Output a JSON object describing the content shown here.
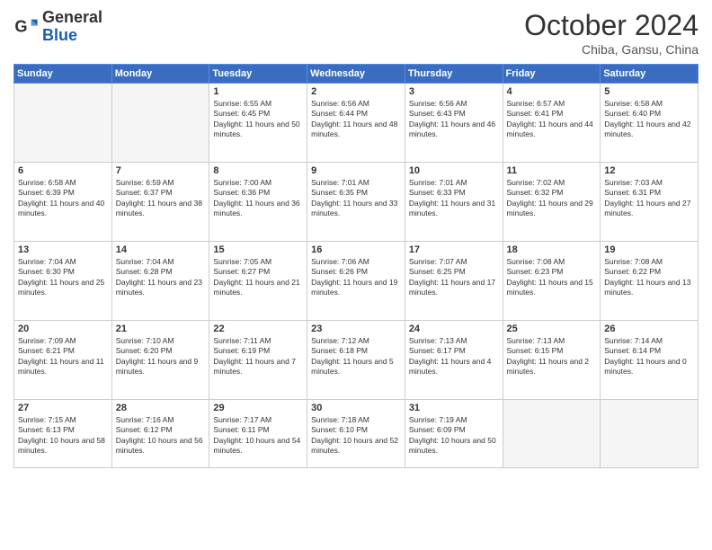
{
  "header": {
    "logo_general": "General",
    "logo_blue": "Blue",
    "month_title": "October 2024",
    "subtitle": "Chiba, Gansu, China"
  },
  "days_of_week": [
    "Sunday",
    "Monday",
    "Tuesday",
    "Wednesday",
    "Thursday",
    "Friday",
    "Saturday"
  ],
  "weeks": [
    [
      {
        "day": "",
        "empty": true
      },
      {
        "day": "",
        "empty": true
      },
      {
        "day": "1",
        "sunrise": "6:55 AM",
        "sunset": "6:45 PM",
        "daylight": "11 hours and 50 minutes."
      },
      {
        "day": "2",
        "sunrise": "6:56 AM",
        "sunset": "6:44 PM",
        "daylight": "11 hours and 48 minutes."
      },
      {
        "day": "3",
        "sunrise": "6:56 AM",
        "sunset": "6:43 PM",
        "daylight": "11 hours and 46 minutes."
      },
      {
        "day": "4",
        "sunrise": "6:57 AM",
        "sunset": "6:41 PM",
        "daylight": "11 hours and 44 minutes."
      },
      {
        "day": "5",
        "sunrise": "6:58 AM",
        "sunset": "6:40 PM",
        "daylight": "11 hours and 42 minutes."
      }
    ],
    [
      {
        "day": "6",
        "sunrise": "6:58 AM",
        "sunset": "6:39 PM",
        "daylight": "11 hours and 40 minutes."
      },
      {
        "day": "7",
        "sunrise": "6:59 AM",
        "sunset": "6:37 PM",
        "daylight": "11 hours and 38 minutes."
      },
      {
        "day": "8",
        "sunrise": "7:00 AM",
        "sunset": "6:36 PM",
        "daylight": "11 hours and 36 minutes."
      },
      {
        "day": "9",
        "sunrise": "7:01 AM",
        "sunset": "6:35 PM",
        "daylight": "11 hours and 33 minutes."
      },
      {
        "day": "10",
        "sunrise": "7:01 AM",
        "sunset": "6:33 PM",
        "daylight": "11 hours and 31 minutes."
      },
      {
        "day": "11",
        "sunrise": "7:02 AM",
        "sunset": "6:32 PM",
        "daylight": "11 hours and 29 minutes."
      },
      {
        "day": "12",
        "sunrise": "7:03 AM",
        "sunset": "6:31 PM",
        "daylight": "11 hours and 27 minutes."
      }
    ],
    [
      {
        "day": "13",
        "sunrise": "7:04 AM",
        "sunset": "6:30 PM",
        "daylight": "11 hours and 25 minutes."
      },
      {
        "day": "14",
        "sunrise": "7:04 AM",
        "sunset": "6:28 PM",
        "daylight": "11 hours and 23 minutes."
      },
      {
        "day": "15",
        "sunrise": "7:05 AM",
        "sunset": "6:27 PM",
        "daylight": "11 hours and 21 minutes."
      },
      {
        "day": "16",
        "sunrise": "7:06 AM",
        "sunset": "6:26 PM",
        "daylight": "11 hours and 19 minutes."
      },
      {
        "day": "17",
        "sunrise": "7:07 AM",
        "sunset": "6:25 PM",
        "daylight": "11 hours and 17 minutes."
      },
      {
        "day": "18",
        "sunrise": "7:08 AM",
        "sunset": "6:23 PM",
        "daylight": "11 hours and 15 minutes."
      },
      {
        "day": "19",
        "sunrise": "7:08 AM",
        "sunset": "6:22 PM",
        "daylight": "11 hours and 13 minutes."
      }
    ],
    [
      {
        "day": "20",
        "sunrise": "7:09 AM",
        "sunset": "6:21 PM",
        "daylight": "11 hours and 11 minutes."
      },
      {
        "day": "21",
        "sunrise": "7:10 AM",
        "sunset": "6:20 PM",
        "daylight": "11 hours and 9 minutes."
      },
      {
        "day": "22",
        "sunrise": "7:11 AM",
        "sunset": "6:19 PM",
        "daylight": "11 hours and 7 minutes."
      },
      {
        "day": "23",
        "sunrise": "7:12 AM",
        "sunset": "6:18 PM",
        "daylight": "11 hours and 5 minutes."
      },
      {
        "day": "24",
        "sunrise": "7:13 AM",
        "sunset": "6:17 PM",
        "daylight": "11 hours and 4 minutes."
      },
      {
        "day": "25",
        "sunrise": "7:13 AM",
        "sunset": "6:15 PM",
        "daylight": "11 hours and 2 minutes."
      },
      {
        "day": "26",
        "sunrise": "7:14 AM",
        "sunset": "6:14 PM",
        "daylight": "11 hours and 0 minutes."
      }
    ],
    [
      {
        "day": "27",
        "sunrise": "7:15 AM",
        "sunset": "6:13 PM",
        "daylight": "10 hours and 58 minutes."
      },
      {
        "day": "28",
        "sunrise": "7:16 AM",
        "sunset": "6:12 PM",
        "daylight": "10 hours and 56 minutes."
      },
      {
        "day": "29",
        "sunrise": "7:17 AM",
        "sunset": "6:11 PM",
        "daylight": "10 hours and 54 minutes."
      },
      {
        "day": "30",
        "sunrise": "7:18 AM",
        "sunset": "6:10 PM",
        "daylight": "10 hours and 52 minutes."
      },
      {
        "day": "31",
        "sunrise": "7:19 AM",
        "sunset": "6:09 PM",
        "daylight": "10 hours and 50 minutes."
      },
      {
        "day": "",
        "empty": true
      },
      {
        "day": "",
        "empty": true
      }
    ]
  ]
}
